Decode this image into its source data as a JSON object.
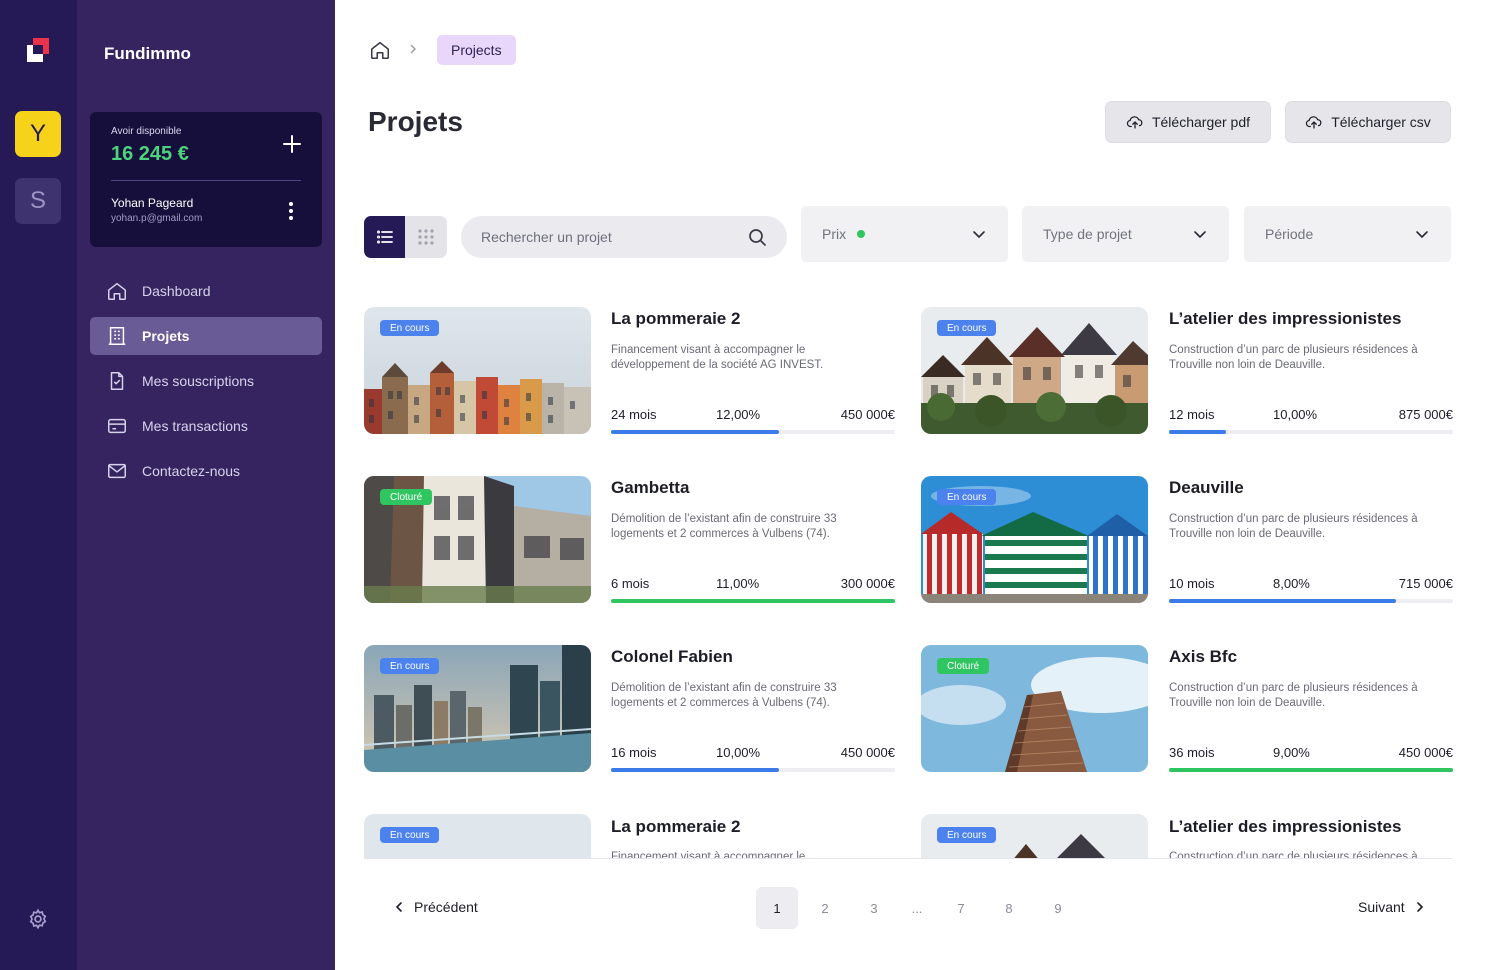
{
  "brand": "Fundimmo",
  "workspaces": [
    {
      "letter": "Y"
    },
    {
      "letter": "S"
    }
  ],
  "wallet": {
    "label": "Avoir disponible",
    "amount": "16 245 €",
    "user_name": "Yohan Pageard",
    "user_email": "yohan.p@gmail.com"
  },
  "nav": [
    {
      "label": "Dashboard",
      "icon": "home-icon"
    },
    {
      "label": "Projets",
      "icon": "building-icon"
    },
    {
      "label": "Mes souscriptions",
      "icon": "document-check-icon"
    },
    {
      "label": "Mes transactions",
      "icon": "credit-card-icon"
    },
    {
      "label": "Contactez-nous",
      "icon": "mail-icon"
    }
  ],
  "breadcrumb": {
    "current": "Projects"
  },
  "page_title": "Projets",
  "actions": {
    "download_pdf": "Télécharger pdf",
    "download_csv": "Télécharger csv"
  },
  "search": {
    "placeholder": "Rechercher un projet"
  },
  "filters": [
    {
      "label": "Prix",
      "indicator_color": "#2fc560"
    },
    {
      "label": "Type de projet"
    },
    {
      "label": "Période"
    }
  ],
  "colors": {
    "accent_dark": "#251a55",
    "progress_blue": "#3b7be9",
    "progress_green": "#2fc560",
    "badge_blue": "#4b82ee",
    "badge_green": "#2fc560"
  },
  "projects": [
    {
      "status": "En cours",
      "title": "La pommeraie 2",
      "description": "Financement visant à accompagner le développement de la société AG INVEST.",
      "duration": "24 mois",
      "rate": "12,00%",
      "amount": "450 000€",
      "progress": 0.59
    },
    {
      "status": "En cours",
      "title": "L’atelier des impressionistes",
      "description": "Construction d’un parc de plusieurs résidences à Trouville non loin de Deauville.",
      "duration": "12 mois",
      "rate": "10,00%",
      "amount": "875 000€",
      "progress": 0.2
    },
    {
      "status": "Cloturé",
      "title": "Gambetta",
      "description": "Démolition de l’existant afin de construire 33 logements et 2 commerces à Vulbens (74).",
      "duration": "6 mois",
      "rate": "11,00%",
      "amount": "300 000€",
      "progress": 1.0
    },
    {
      "status": "En cours",
      "title": "Deauville",
      "description": "Construction d’un parc de plusieurs résidences à Trouville non loin de Deauville.",
      "duration": "10 mois",
      "rate": "8,00%",
      "amount": "715 000€",
      "progress": 0.8
    },
    {
      "status": "En cours",
      "title": "Colonel Fabien",
      "description": "Démolition de l’existant afin de construire 33 logements et 2 commerces à Vulbens (74).",
      "duration": "16 mois",
      "rate": "10,00%",
      "amount": "450 000€",
      "progress": 0.59
    },
    {
      "status": "Cloturé",
      "title": "Axis Bfc",
      "description": "Construction d’un parc de plusieurs résidences à Trouville non loin de Deauville.",
      "duration": "36 mois",
      "rate": "9,00%",
      "amount": "450 000€",
      "progress": 1.0
    },
    {
      "status": "En cours",
      "title": "La pommeraie 2",
      "description": "Financement visant à accompagner le développement de la société AG INVEST.",
      "duration": "",
      "rate": "",
      "amount": "",
      "progress": null
    },
    {
      "status": "En cours",
      "title": "L’atelier des impressionistes",
      "description": "Construction d’un parc de plusieurs résidences à Trouville non loin de Deauville.",
      "duration": "",
      "rate": "",
      "amount": "",
      "progress": null
    }
  ],
  "pagination": {
    "prev": "Précédent",
    "next": "Suivant",
    "pages": [
      "1",
      "2",
      "3",
      "...",
      "7",
      "8",
      "9"
    ],
    "current": "1"
  }
}
